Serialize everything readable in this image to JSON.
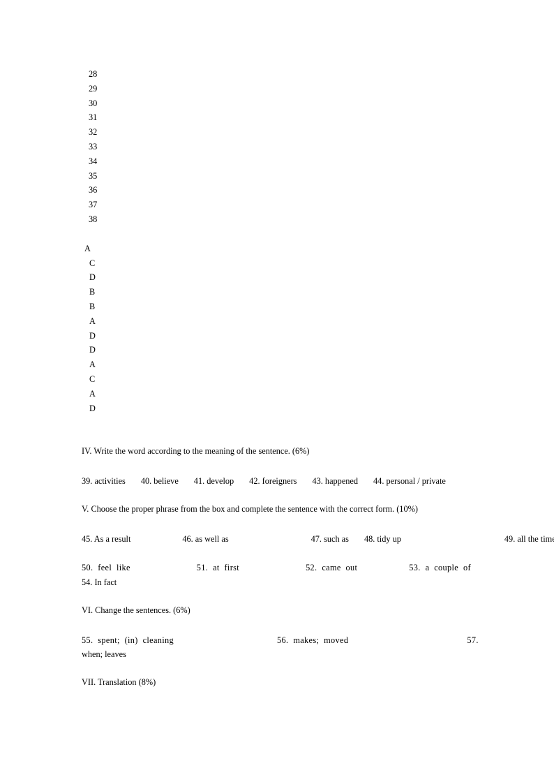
{
  "document": {
    "page_background": "#ffffff",
    "text_color": "#000000"
  },
  "answer_key": {
    "numbered_items": [
      "28",
      "29",
      "30",
      "31",
      "32",
      "33",
      "34",
      "35",
      "36",
      "37",
      "38"
    ],
    "lettered_items": [
      "A",
      "C",
      "D",
      "B",
      "B",
      "A",
      "D",
      "D",
      "A",
      "C",
      "A",
      "D"
    ]
  },
  "sections": {
    "section_iv": {
      "heading": "IV. Write the word according to the meaning of the sentence. (6%)",
      "answers": [
        "39. activities",
        "40. believe",
        "41. develop",
        "42. foreigners",
        "43. happened",
        "44. personal / private"
      ]
    },
    "section_v": {
      "heading": "V. Choose the proper phrase from the box and complete the sentence with the correct form. (10%)",
      "answers_line1": [
        "45. As a result",
        "46. as well as",
        "47. such as",
        "48. tidy up",
        "49. all the time"
      ],
      "answers_line2": [
        "50.  feel  like",
        "51.  at  first",
        "52.  came  out",
        "53.  a  couple  of"
      ],
      "answers_line3": "54. In fact"
    },
    "section_vi": {
      "heading": "VI. Change the sentences. (6%)",
      "answers_line1": [
        "55.  spent;  (in)  cleaning",
        "56.  makes;  moved",
        "57."
      ],
      "answers_line2": "when; leaves"
    },
    "section_vii": {
      "heading": "VII. Translation (8%)"
    }
  }
}
